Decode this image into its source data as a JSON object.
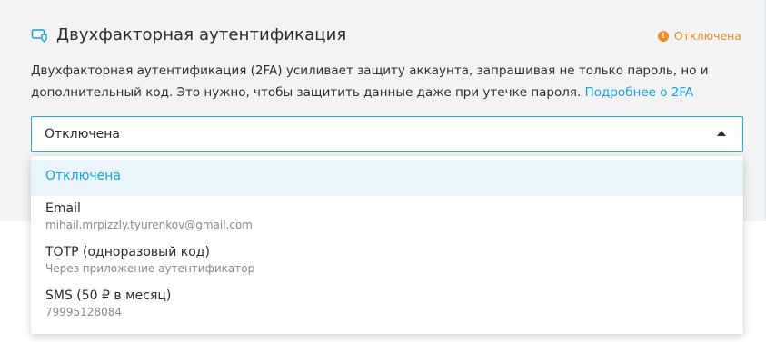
{
  "section": {
    "title": "Двухфакторная аутентификация",
    "status_label": "Отключена",
    "status_icon": "alert-circle-icon",
    "description": "Двухфакторная аутентификация (2FA) усиливает защиту аккаунта, запрашивая не только пароль, но и дополнительный код. Это нужно, чтобы защитить данные даже при утечке пароля.",
    "more_link": "Подробнее о 2FA"
  },
  "select": {
    "value": "Отключена",
    "options": [
      {
        "label": "Отключена",
        "sub": ""
      },
      {
        "label": "Email",
        "sub": "mihail.mrpizzly.tyurenkov@gmail.com"
      },
      {
        "label": "TOTP (одноразовый код)",
        "sub": "Через приложение аутентификатор"
      },
      {
        "label": "SMS (50 ₽ в месяц)",
        "sub": "79995128084"
      }
    ]
  },
  "colors": {
    "accent": "#1ba2d6",
    "warning": "#f08a24",
    "card_bg": "#f1f3f5",
    "selected_option_bg": "#e9f5fa"
  }
}
